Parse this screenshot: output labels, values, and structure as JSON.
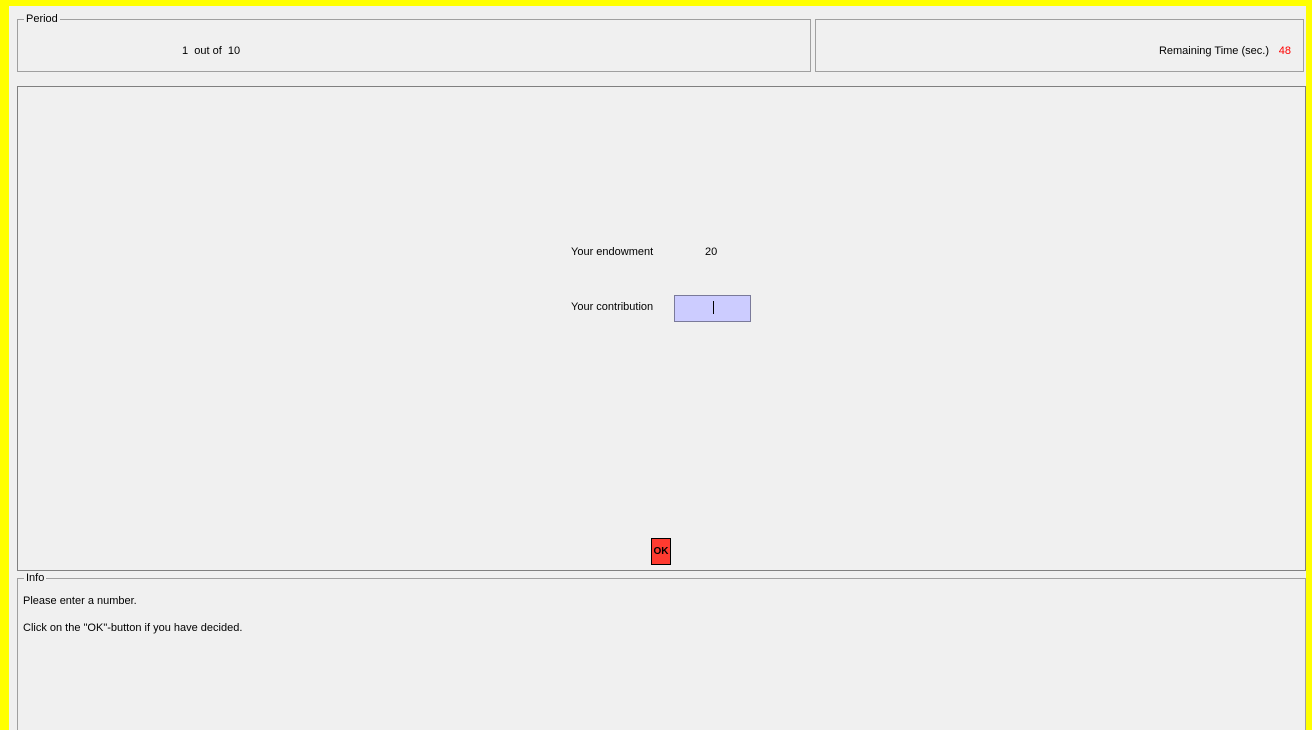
{
  "period": {
    "legend": "Period",
    "current": "1",
    "out_of_label": "out of",
    "total": "10"
  },
  "timer": {
    "label": "Remaining Time (sec.)",
    "value": "48"
  },
  "decision": {
    "endowment_label": "Your endowment",
    "endowment_value": "20",
    "contribution_label": "Your contribution",
    "contribution_value": "",
    "ok_label": "OK"
  },
  "info": {
    "legend": "Info",
    "line1": "Please enter a number.",
    "line2": "Click on the \"OK\"-button if you have decided."
  },
  "colors": {
    "frame": "#ffff00",
    "timer_value": "#ff0000",
    "input_bg": "#ccccff",
    "ok_button": "#ff3b30",
    "panel_bg": "#f0f0f0"
  }
}
